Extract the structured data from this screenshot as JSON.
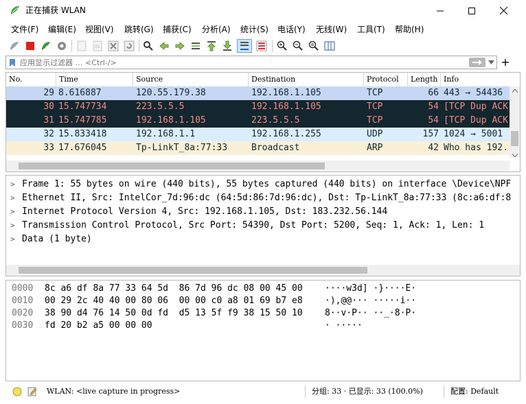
{
  "window": {
    "title": "正在捕获 WLAN"
  },
  "menu": [
    "文件(F)",
    "编辑(E)",
    "视图(V)",
    "跳转(G)",
    "捕获(C)",
    "分析(A)",
    "统计(S)",
    "电话(Y)",
    "无线(W)",
    "工具(T)",
    "帮助(H)"
  ],
  "filter": {
    "placeholder": "应用显示过滤器 … <Ctrl-/>"
  },
  "columns": [
    "No.",
    "Time",
    "Source",
    "Destination",
    "Protocol",
    "Length",
    "Info"
  ],
  "packets": [
    {
      "no": "29",
      "time": "8.616887",
      "src": "120.55.179.38",
      "dst": "192.168.1.105",
      "proto": "TCP",
      "len": "66",
      "info": "443 → 54436",
      "bg": "#c6d7f4",
      "fg": "#12272e"
    },
    {
      "no": "30",
      "time": "15.747734",
      "src": "223.5.5.5",
      "dst": "192.168.1.105",
      "proto": "TCP",
      "len": "54",
      "info": "[TCP Dup ACK",
      "bg": "#12272e",
      "fg": "#f78787"
    },
    {
      "no": "31",
      "time": "15.747785",
      "src": "192.168.1.105",
      "dst": "223.5.5.5",
      "proto": "TCP",
      "len": "54",
      "info": "[TCP Dup ACK",
      "bg": "#12272e",
      "fg": "#f78787"
    },
    {
      "no": "32",
      "time": "15.833418",
      "src": "192.168.1.1",
      "dst": "192.168.1.255",
      "proto": "UDP",
      "len": "157",
      "info": "1024 → 5001",
      "bg": "#daeeff",
      "fg": "#12272e"
    },
    {
      "no": "33",
      "time": "17.676045",
      "src": "Tp-LinkT_8a:77:33",
      "dst": "Broadcast",
      "proto": "ARP",
      "len": "42",
      "info": "Who has 192.",
      "bg": "#faf0d7",
      "fg": "#12272e"
    }
  ],
  "details": [
    "Frame 1: 55 bytes on wire (440 bits), 55 bytes captured (440 bits) on interface \\Device\\NPF",
    "Ethernet II, Src: IntelCor_7d:96:dc (64:5d:86:7d:96:dc), Dst: Tp-LinkT_8a:77:33 (8c:a6:df:8",
    "Internet Protocol Version 4, Src: 192.168.1.105, Dst: 183.232.56.144",
    "Transmission Control Protocol, Src Port: 54390, Dst Port: 5200, Seq: 1, Ack: 1, Len: 1",
    "Data (1 byte)"
  ],
  "hex": [
    {
      "offset": "0000",
      "bytes": "8c a6 df 8a 77 33 64 5d  86 7d 96 dc 08 00 45 00",
      "ascii": "····w3d] ·}····E·"
    },
    {
      "offset": "0010",
      "bytes": "00 29 2c 40 40 00 80 06  00 00 c0 a8 01 69 b7 e8",
      "ascii": "·),@@··· ·····i··"
    },
    {
      "offset": "0020",
      "bytes": "38 90 d4 76 14 50 0d fd  d5 13 5f f9 38 15 50 10",
      "ascii": "8··v·P·· ··_·8·P·"
    },
    {
      "offset": "0030",
      "bytes": "fd 20 b2 a5 00 00 00",
      "ascii": "· ·····"
    }
  ],
  "status": {
    "capture": "WLAN: <live capture in progress>",
    "packets": "分组: 33 · 已显示: 33 (100.0%)",
    "profile": "配置: Default"
  },
  "colors": {
    "selected": "#c6d7f4",
    "bad_tcp_bg": "#12272e",
    "bad_tcp_fg": "#f78787",
    "udp_bg": "#daeeff",
    "arp_bg": "#faf0d7"
  }
}
